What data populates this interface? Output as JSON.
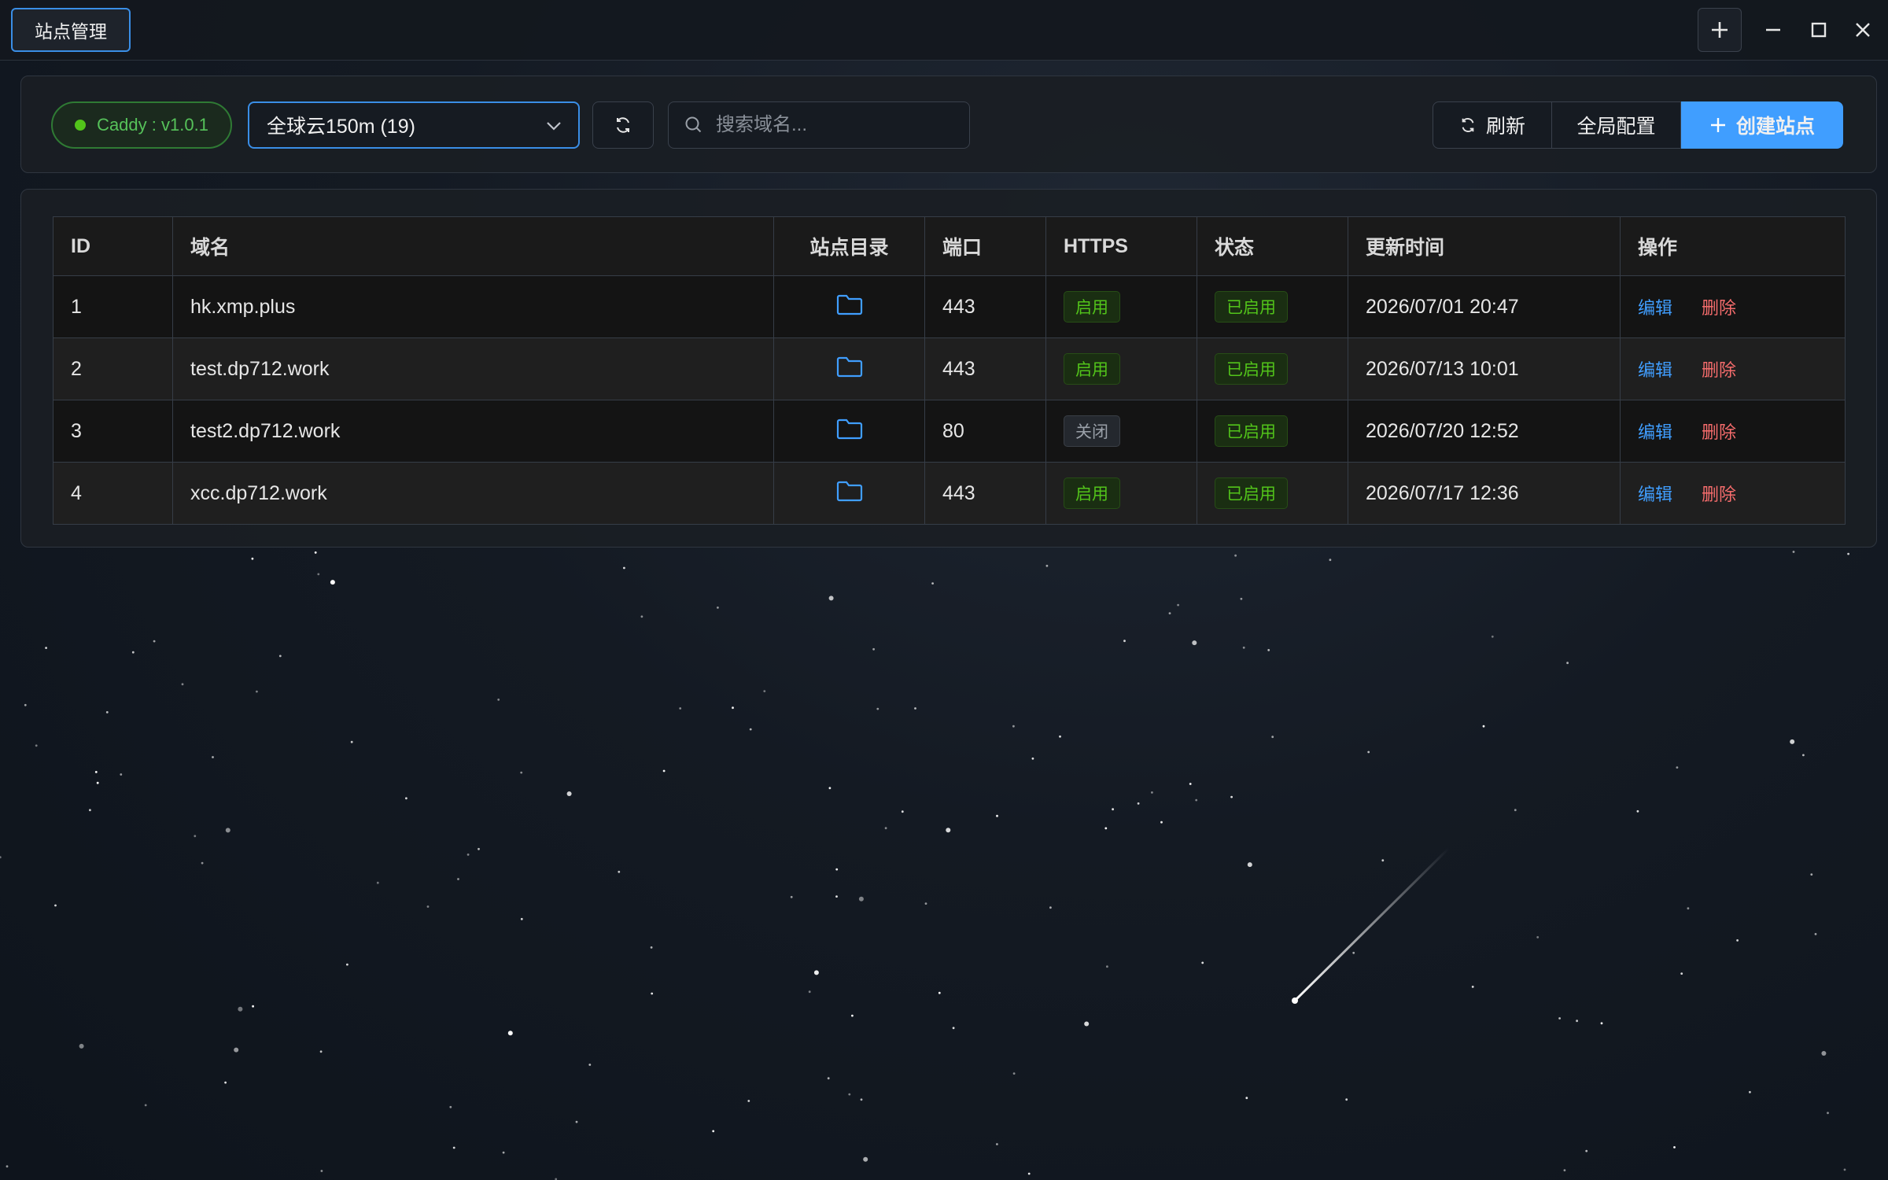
{
  "window": {
    "tab_title": "站点管理",
    "controls": [
      "plus-icon",
      "minimize-icon",
      "maximize-icon",
      "close-icon"
    ]
  },
  "toolbar": {
    "caddy_status": "Caddy : v1.0.1",
    "server_select": "全球云150m (19)",
    "search_placeholder": "搜索域名...",
    "refresh_label": "刷新",
    "global_config_label": "全局配置",
    "create_label": "创建站点"
  },
  "table": {
    "headers": {
      "id": "ID",
      "domain": "域名",
      "site_dir": "站点目录",
      "port": "端口",
      "https": "HTTPS",
      "status": "状态",
      "updated": "更新时间",
      "actions": "操作"
    },
    "rows": [
      {
        "id": "1",
        "domain": "hk.xmp.plus",
        "port": "443",
        "https": "启用",
        "https_on": true,
        "status": "已启用",
        "updated": "2026/07/01 20:47",
        "edit": "编辑",
        "delete": "删除"
      },
      {
        "id": "2",
        "domain": "test.dp712.work",
        "port": "443",
        "https": "启用",
        "https_on": true,
        "status": "已启用",
        "updated": "2026/07/13 10:01",
        "edit": "编辑",
        "delete": "删除"
      },
      {
        "id": "3",
        "domain": "test2.dp712.work",
        "port": "80",
        "https": "关闭",
        "https_on": false,
        "status": "已启用",
        "updated": "2026/07/20 12:52",
        "edit": "编辑",
        "delete": "删除"
      },
      {
        "id": "4",
        "domain": "xcc.dp712.work",
        "port": "443",
        "https": "启用",
        "https_on": true,
        "status": "已启用",
        "updated": "2026/07/17 12:36",
        "edit": "编辑",
        "delete": "删除"
      }
    ]
  },
  "colors": {
    "accent": "#409eff",
    "success": "#52c41a",
    "danger": "#f56c6c",
    "background": "#141a23"
  }
}
